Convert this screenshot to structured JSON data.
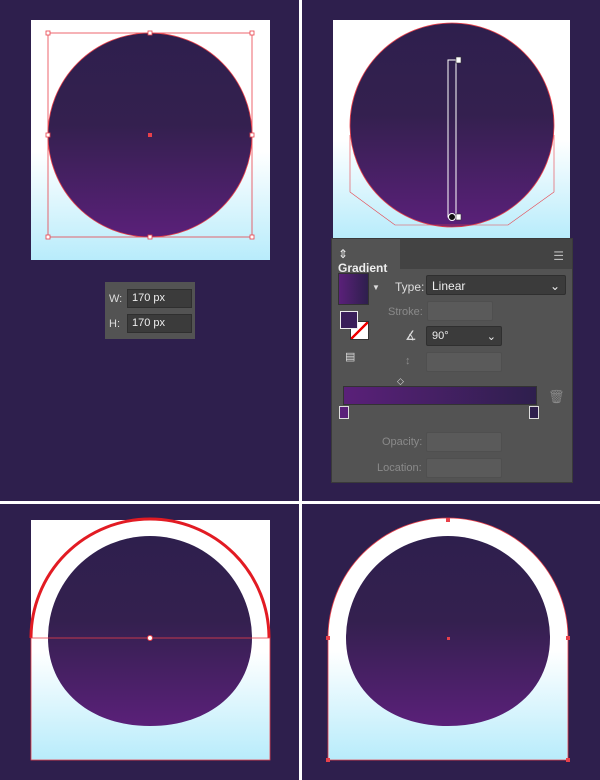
{
  "colors": {
    "background": "#2e1f4d",
    "gradient_start": "#5a2079",
    "gradient_end": "#2e1f4d",
    "artboard_bottom": "#b8ecfb",
    "selection": "#e8404a"
  },
  "size_panel": {
    "w_label": "W:",
    "w_value": "170 px",
    "h_label": "H:",
    "h_value": "170 px"
  },
  "gradient_panel": {
    "tab": "Gradient",
    "tab_icon": "updown-chevron-icon",
    "menu_icon": "hamburger-menu-icon",
    "type_label": "Type:",
    "type_value": "Linear",
    "stroke_label": "Stroke:",
    "angle_value": "90°",
    "opacity_label": "Opacity:",
    "location_label": "Location:"
  }
}
